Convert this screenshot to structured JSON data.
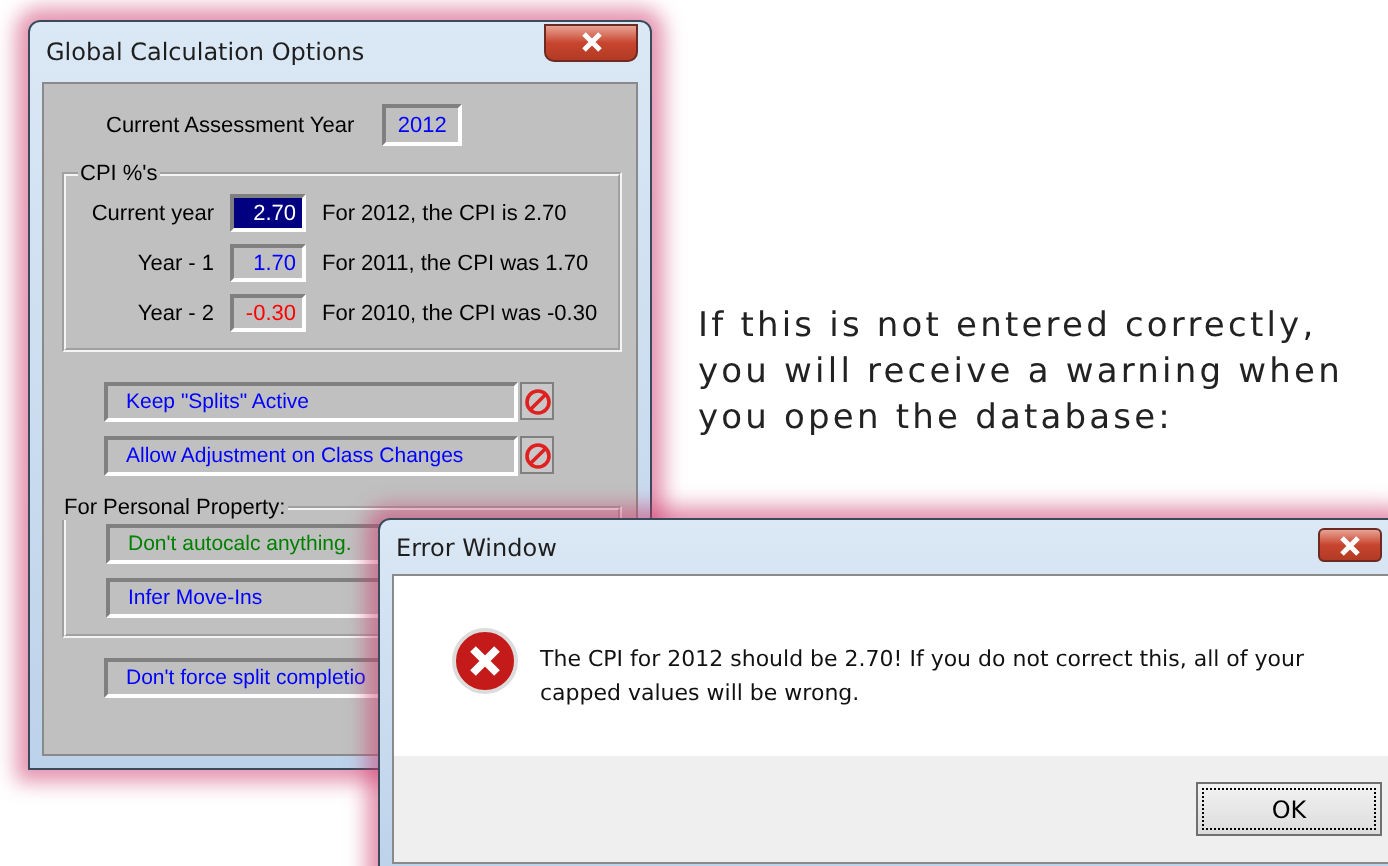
{
  "settings_window": {
    "title": "Global Calculation Options",
    "assessment_year": {
      "label": "Current Assessment Year",
      "value": "2012"
    },
    "cpi_group": {
      "title": "CPI %'s",
      "rows": [
        {
          "label": "Current year",
          "value": "2.70",
          "note": "For 2012, the CPI is 2.70",
          "selected": true,
          "color": "#000080"
        },
        {
          "label": "Year - 1",
          "value": "1.70",
          "note": "For 2011, the CPI was 1.70",
          "selected": false,
          "color": "#0000ff"
        },
        {
          "label": "Year - 2",
          "value": "-0.30",
          "note": "For 2010, the CPI was -0.30",
          "selected": false,
          "color": "#ff0000"
        }
      ]
    },
    "options": [
      {
        "label": "Keep \"Splits\" Active",
        "color": "#0000ff",
        "blocked": true
      },
      {
        "label": "Allow Adjustment on Class Changes",
        "color": "#0000ff",
        "blocked": true
      }
    ],
    "personal_property": {
      "title": "For Personal Property:",
      "options": [
        {
          "label": "Don't autocalc anything.",
          "color": "#008000"
        },
        {
          "label": "Infer Move-Ins",
          "color": "#0000ff"
        }
      ]
    },
    "bottom_option": {
      "label": "Don't force split completio",
      "color": "#0000ff"
    }
  },
  "paragraph": "If this is not entered correctly, you will receive a warning when you open the database:",
  "error_window": {
    "title": "Error Window",
    "message": "The CPI for 2012 should be 2.70!  If you do not correct this, all of your capped values will be wrong.",
    "button": "OK"
  }
}
